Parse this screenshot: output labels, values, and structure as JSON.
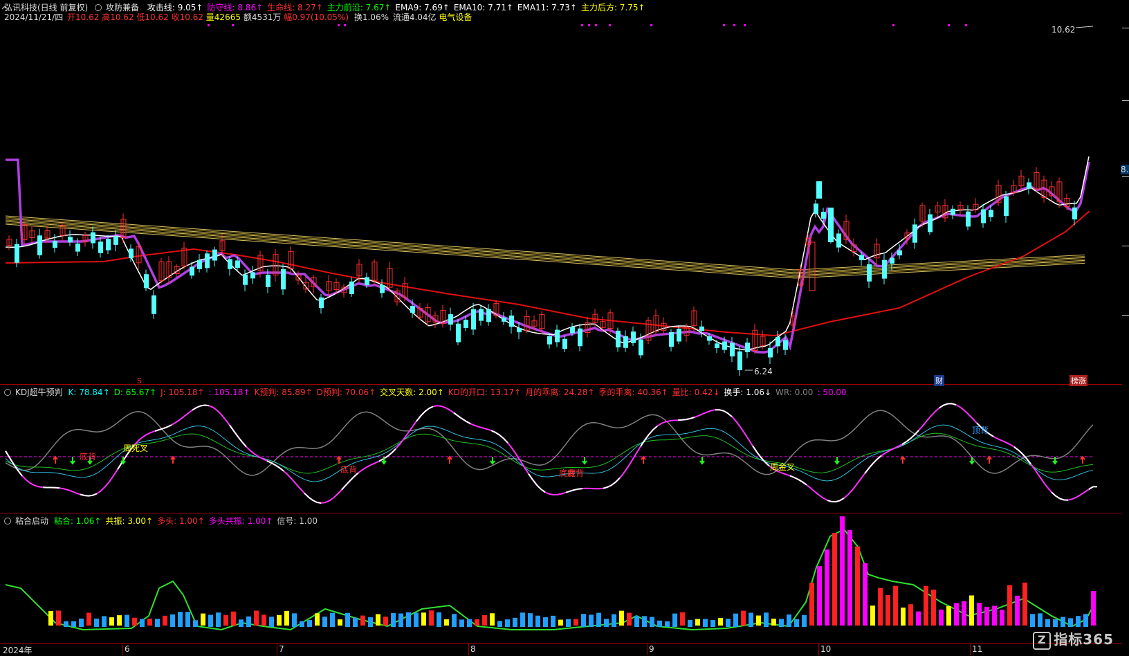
{
  "header": {
    "stock": "弘讯科技(日线 前复权)",
    "indicator": "攻防兼备",
    "items": [
      {
        "t": "攻击线: 9.05",
        "c": "#ffffff"
      },
      {
        "t": "防守线: 8.86",
        "c": "#ff00ff"
      },
      {
        "t": "生命线: 8.27",
        "c": "#ff3030"
      },
      {
        "t": "主力前沿: 7.67",
        "c": "#00ff00"
      },
      {
        "t": "EMA9: 7.69",
        "c": "#ffffff"
      },
      {
        "t": "EMA10: 7.71",
        "c": "#ffffff"
      },
      {
        "t": "EMA11: 7.73",
        "c": "#ffffff"
      },
      {
        "t": "主力后方: 7.75",
        "c": "#ffff00"
      }
    ],
    "arrow": "↑"
  },
  "quote": {
    "date": "2024/11/21/四",
    "open": "开10.62",
    "high": "高10.62",
    "low": "低10.62",
    "close": "收10.62",
    "volume": "量42665",
    "amount": "额4531万",
    "change": "幅0.97(10.05%)",
    "turnover": "换1.06%",
    "float": "流通4.04亿",
    "sector": "电气设备"
  },
  "price_labels": {
    "high": "10.62",
    "low": "6.24",
    "right_cut": "8."
  },
  "chart_marks": {
    "s": "S",
    "cai": "财",
    "bang": "榜涨"
  },
  "kdj": {
    "title": "KDJ超牛预判",
    "items": [
      {
        "t": "K: 78.84↑",
        "c": "#00ffff"
      },
      {
        "t": "D: 65.67↑",
        "c": "#00ff00"
      },
      {
        "t": "J: 105.18↑",
        "c": "#ff3030"
      },
      {
        "t": ": 105.18↑",
        "c": "#ff00ff"
      },
      {
        "t": "K预判: 85.89↑",
        "c": "#ff3030"
      },
      {
        "t": "D预判: 70.06↑",
        "c": "#ff3030"
      },
      {
        "t": "交叉天数: 2.00↑",
        "c": "#ffff00"
      },
      {
        "t": "KD的开口: 13.17↑",
        "c": "#ff3030"
      },
      {
        "t": "月的乖离: 24.28↑",
        "c": "#ff3030"
      },
      {
        "t": "季的乖离: 40.36↑",
        "c": "#ff3030"
      },
      {
        "t": "量比: 0.42↓",
        "c": "#ff3030"
      },
      {
        "t": "换手: 1.06↓",
        "c": "#ffffff"
      },
      {
        "t": "WR: 0.00",
        "c": "#808080"
      },
      {
        "t": ": 50.00",
        "c": "#ff00ff"
      }
    ],
    "labels": [
      "周死叉",
      "底背",
      "底背",
      "底背",
      "顶背",
      "周金叉",
      "底背"
    ]
  },
  "nh": {
    "title": "粘合启动",
    "items": [
      {
        "t": "粘合: 1.06↑",
        "c": "#00ff00"
      },
      {
        "t": "共振: 3.00↑",
        "c": "#ffff00"
      },
      {
        "t": "多头: 1.00↑",
        "c": "#ff3030"
      },
      {
        "t": "多头共振: 1.00↑",
        "c": "#ff00ff"
      },
      {
        "t": "信号: 1.00",
        "c": "#cccccc"
      }
    ]
  },
  "xaxis": [
    "2024年",
    "6",
    "7",
    "8",
    "9",
    "10",
    "11"
  ],
  "logo": "指标365"
}
